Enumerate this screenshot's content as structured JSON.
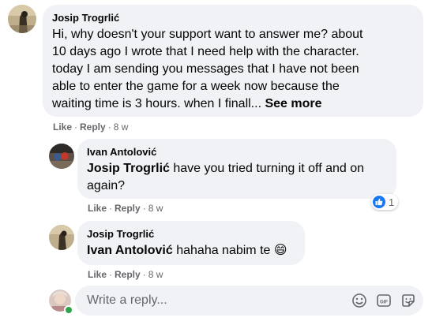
{
  "comments": [
    {
      "author": "Josip Trogrlić",
      "lines": [
        "Hi, why doesn't your support want to answer me? about",
        "10 days ago I wrote that I need help with the character.",
        "today I am sending you messages that I have not been",
        "able to enter the game for a week now because the",
        "waiting time is 3 hours. when I finall..."
      ],
      "see_more": "See more",
      "like": "Like",
      "reply": "Reply",
      "time": "8 w"
    },
    {
      "author": "Ivan Antolović",
      "mention": "Josip Trogrlić",
      "line1": "have you tried turning it off and on",
      "line2": "again?",
      "reaction_count": "1",
      "like": "Like",
      "reply": "Reply",
      "time": "8 w"
    },
    {
      "author": "Josip Trogrlić",
      "mention": "Ivan Antolović",
      "text": "hahaha nabim te",
      "emoji": "😄",
      "like": "Like",
      "reply": "Reply",
      "time": "8 w"
    }
  ],
  "reply_box": {
    "placeholder": "Write a reply...",
    "icons": [
      "emoji-icon",
      "gif-icon",
      "sticker-icon"
    ]
  },
  "colors": {
    "bubble": "#f0f2f5",
    "meta_text": "#65676b",
    "like_blue": "#1877f2",
    "online_green": "#31a24c"
  }
}
